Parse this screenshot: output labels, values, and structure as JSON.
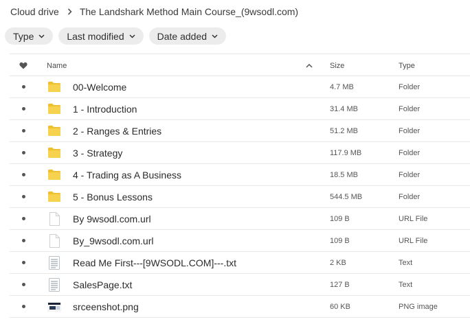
{
  "breadcrumb": {
    "root": "Cloud drive",
    "current": "The Landshark Method Main Course_(9wsodl.com)"
  },
  "filters": [
    {
      "label": "Type"
    },
    {
      "label": "Last modified"
    },
    {
      "label": "Date added"
    }
  ],
  "table": {
    "headers": {
      "name": "Name",
      "size": "Size",
      "type": "Type"
    },
    "rows": [
      {
        "name": "00-Welcome",
        "size": "4.7 MB",
        "type": "Folder",
        "icon": "folder-icon"
      },
      {
        "name": "1 - Introduction",
        "size": "31.4 MB",
        "type": "Folder",
        "icon": "folder-icon"
      },
      {
        "name": "2 - Ranges & Entries",
        "size": "51.2 MB",
        "type": "Folder",
        "icon": "folder-icon"
      },
      {
        "name": "3 - Strategy",
        "size": "117.9 MB",
        "type": "Folder",
        "icon": "folder-icon"
      },
      {
        "name": "4 - Trading as A Business",
        "size": "18.5 MB",
        "type": "Folder",
        "icon": "folder-icon"
      },
      {
        "name": "5 - Bonus Lessons",
        "size": "544.5 MB",
        "type": "Folder",
        "icon": "folder-icon"
      },
      {
        "name": "By 9wsodl.com.url",
        "size": "109 B",
        "type": "URL File",
        "icon": "file-icon"
      },
      {
        "name": "By_9wsodl.com.url",
        "size": "109 B",
        "type": "URL File",
        "icon": "file-icon"
      },
      {
        "name": "Read Me First---[9WSODL.COM]---.txt",
        "size": "2 KB",
        "type": "Text",
        "icon": "text-file-icon"
      },
      {
        "name": "SalesPage.txt",
        "size": "127 B",
        "type": "Text",
        "icon": "text-file-icon"
      },
      {
        "name": "srceenshot.png",
        "size": "60 KB",
        "type": "PNG image",
        "icon": "image-file-icon"
      }
    ]
  },
  "colors": {
    "folder": "#f7d24f",
    "folder_tab": "#efbf33",
    "chip_bg": "#ececec",
    "divider": "#e6e6e6"
  }
}
